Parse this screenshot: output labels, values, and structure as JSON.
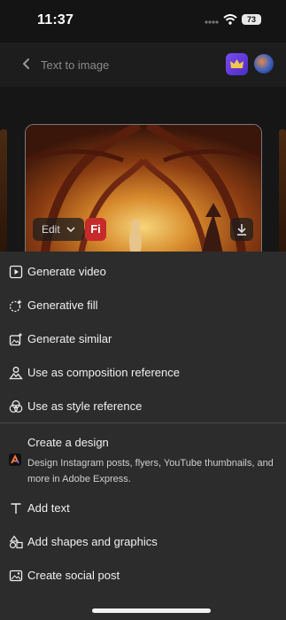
{
  "status_bar": {
    "time": "11:37",
    "battery": "73"
  },
  "header": {
    "title": "Text to image"
  },
  "image_overlay": {
    "edit_label": "Edit",
    "badge_label": "Fi"
  },
  "menu": {
    "items": [
      {
        "label": "Generate video",
        "icon": "play-square-icon"
      },
      {
        "label": "Generative fill",
        "icon": "sparkle-brush-icon"
      },
      {
        "label": "Generate similar",
        "icon": "image-sparkle-icon"
      },
      {
        "label": "Use as composition reference",
        "icon": "composition-icon"
      },
      {
        "label": "Use as style reference",
        "icon": "style-circles-icon"
      }
    ],
    "create_design": {
      "title": "Create a design",
      "description": "Design Instagram posts, flyers, YouTube thumbnails, and more in Adobe Express."
    },
    "bottom_items": [
      {
        "label": "Add text",
        "icon": "text-t-icon"
      },
      {
        "label": "Add shapes and graphics",
        "icon": "shapes-icon"
      },
      {
        "label": "Create social post",
        "icon": "image-frame-icon"
      }
    ]
  },
  "colors": {
    "sheet": "#2c2c2c",
    "header": "#1d1d1d",
    "accent_badge": "#c62b2b",
    "premium": "#7b4cf0"
  }
}
